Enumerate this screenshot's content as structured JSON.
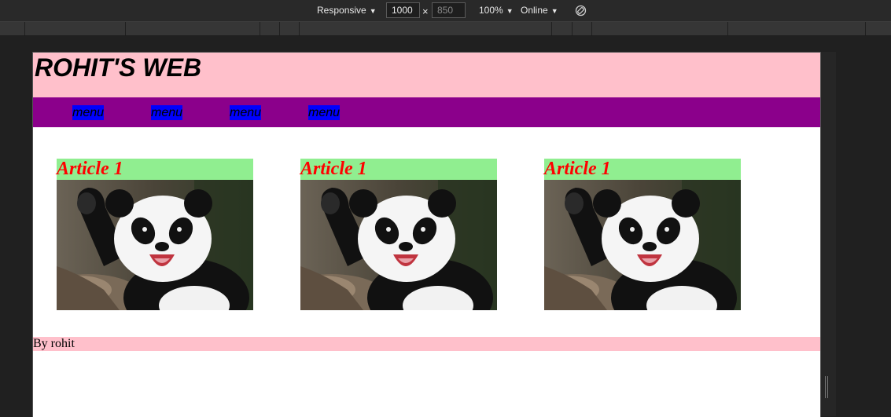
{
  "devtools": {
    "device": "Responsive",
    "width": "1000",
    "times": "×",
    "height": "850",
    "zoom": "100%",
    "network": "Online"
  },
  "page": {
    "title": "ROHIT'S WEB",
    "nav": [
      "menu",
      "menu",
      "menu",
      "menu"
    ],
    "articles": [
      {
        "title": "Article 1",
        "image": "panda"
      },
      {
        "title": "Article 1",
        "image": "panda"
      },
      {
        "title": "Article 1",
        "image": "panda"
      }
    ],
    "footer": "By rohit"
  },
  "colors": {
    "header_bg": "#ffc0cb",
    "nav_bg": "#8b008b",
    "nav_item_bg": "#0000ff",
    "article_title_bg": "#90ee90",
    "article_title_color": "#ff0000",
    "footer_bg": "#ffc0cb"
  }
}
